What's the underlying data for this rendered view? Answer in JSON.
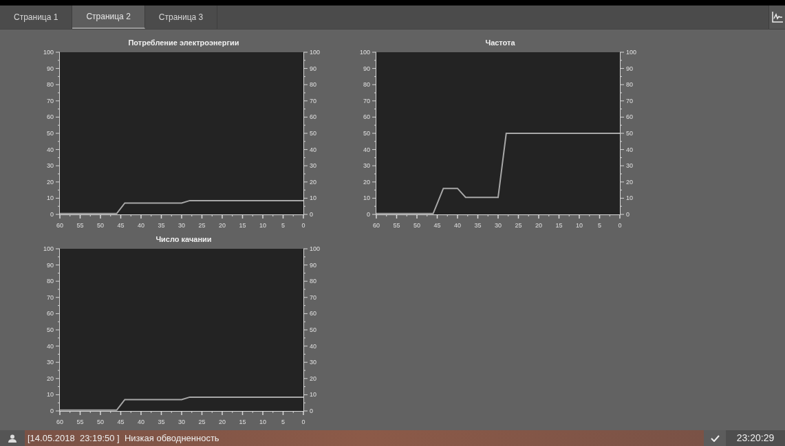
{
  "tabs": [
    {
      "label": "Страница 1",
      "selected": false
    },
    {
      "label": "Страница 2",
      "selected": true
    },
    {
      "label": "Страница 3",
      "selected": false
    }
  ],
  "charts": [
    {
      "chart_data": {
        "type": "line",
        "title": "Потребление электроэнергии",
        "x": [
          60,
          46,
          44,
          30,
          28,
          0
        ],
        "series": [
          {
            "color": "#a8a8a8",
            "values": [
              0.5,
              0.5,
              7,
              7,
              8.5,
              8.5
            ]
          }
        ],
        "xlim": [
          60,
          0
        ],
        "ylim": [
          0,
          100
        ],
        "xticks": [
          60,
          55,
          50,
          45,
          40,
          35,
          30,
          25,
          20,
          15,
          10,
          5,
          0
        ],
        "yticks": [
          0,
          10,
          20,
          30,
          40,
          50,
          60,
          70,
          80,
          90,
          100
        ]
      },
      "right_yticks": [
        "100",
        "90",
        "80",
        "70",
        "60",
        "50",
        "40",
        "30",
        "20",
        "10",
        "0"
      ]
    },
    {
      "chart_data": {
        "type": "line",
        "title": "Частота",
        "x": [
          60,
          46,
          43.5,
          40,
          38,
          30,
          28,
          0
        ],
        "series": [
          {
            "color": "#a8a8a8",
            "values": [
              0.5,
              0.5,
              16,
              16,
              10.5,
              10.5,
              50,
              50
            ]
          }
        ],
        "xlim": [
          60,
          0
        ],
        "ylim": [
          0,
          100
        ],
        "xticks": [
          60,
          55,
          50,
          45,
          40,
          35,
          30,
          25,
          20,
          15,
          10,
          5,
          0
        ],
        "yticks": [
          0,
          10,
          20,
          30,
          40,
          50,
          60,
          70,
          80,
          90,
          100
        ]
      },
      "right_yticks": [
        "100",
        "90",
        "80",
        "70",
        "60",
        "50",
        "40",
        "30",
        "20",
        "10",
        "0"
      ]
    },
    {
      "chart_data": {
        "type": "line",
        "title": "Число качании",
        "x": [
          60,
          46,
          44,
          30,
          28,
          0
        ],
        "series": [
          {
            "color": "#a8a8a8",
            "values": [
              0.5,
              0.5,
              7,
              7,
              8.5,
              8.5
            ]
          }
        ],
        "xlim": [
          60,
          0
        ],
        "ylim": [
          0,
          100
        ],
        "xticks": [
          60,
          55,
          50,
          45,
          40,
          35,
          30,
          25,
          20,
          15,
          10,
          5,
          0
        ],
        "yticks": [
          0,
          10,
          20,
          30,
          40,
          50,
          60,
          70,
          80,
          90,
          100
        ]
      },
      "right_yticks": [
        "100",
        "90",
        "80",
        "70",
        "60",
        "50",
        "40",
        "30",
        "20",
        "10",
        "0"
      ]
    }
  ],
  "status_bar": {
    "message": "[14.05.2018  23:19:50 ]  Низкая обводненность",
    "time": "23:20:29"
  }
}
